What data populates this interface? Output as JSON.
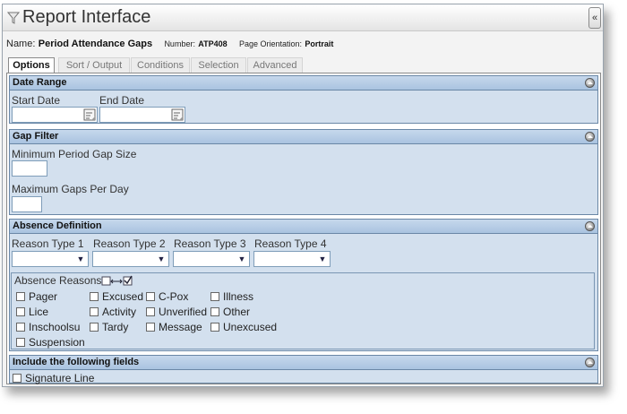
{
  "window": {
    "title": "Report Interface",
    "collapse_glyph": "«"
  },
  "report": {
    "name_label": "Name:",
    "name": "Period Attendance Gaps",
    "number_label": "Number:",
    "number": "ATP408",
    "orientation_label": "Page Orientation:",
    "orientation": "Portrait"
  },
  "tabs": [
    {
      "label": "Options",
      "active": true
    },
    {
      "label": "Sort / Output",
      "active": false
    },
    {
      "label": "Conditions",
      "active": false
    },
    {
      "label": "Selection",
      "active": false
    },
    {
      "label": "Advanced",
      "active": false
    }
  ],
  "date_range": {
    "title": "Date Range",
    "start_label": "Start Date",
    "start_value": "",
    "end_label": "End Date",
    "end_value": ""
  },
  "gap_filter": {
    "title": "Gap Filter",
    "min_label": "Minimum Period Gap Size",
    "min_value": "",
    "max_label": "Maximum Gaps Per Day",
    "max_value": ""
  },
  "absence_definition": {
    "title": "Absence Definition",
    "reason_types": [
      {
        "label": "Reason Type 1",
        "value": ""
      },
      {
        "label": "Reason Type 2",
        "value": ""
      },
      {
        "label": "Reason Type 3",
        "value": ""
      },
      {
        "label": "Reason Type 4",
        "value": ""
      }
    ],
    "reasons_label": "Absence Reasons",
    "reasons": [
      {
        "label": "Pager",
        "checked": false
      },
      {
        "label": "Excused",
        "checked": false
      },
      {
        "label": "C-Pox",
        "checked": false
      },
      {
        "label": "Illness",
        "checked": false
      },
      {
        "label": "Lice",
        "checked": false
      },
      {
        "label": "Activity",
        "checked": false
      },
      {
        "label": "Unverified",
        "checked": false
      },
      {
        "label": "Other",
        "checked": false
      },
      {
        "label": "Inschoolsu",
        "checked": false
      },
      {
        "label": "Tardy",
        "checked": false
      },
      {
        "label": "Message",
        "checked": false
      },
      {
        "label": "Unexcused",
        "checked": false
      },
      {
        "label": "Suspension",
        "checked": false
      }
    ]
  },
  "include_fields": {
    "title": "Include the following fields",
    "fields": [
      {
        "label": "Signature Line",
        "checked": false
      }
    ]
  },
  "colors": {
    "section_bg": "#d3e0ee",
    "section_header": "#a9c3e0",
    "border": "#6a87a6"
  }
}
